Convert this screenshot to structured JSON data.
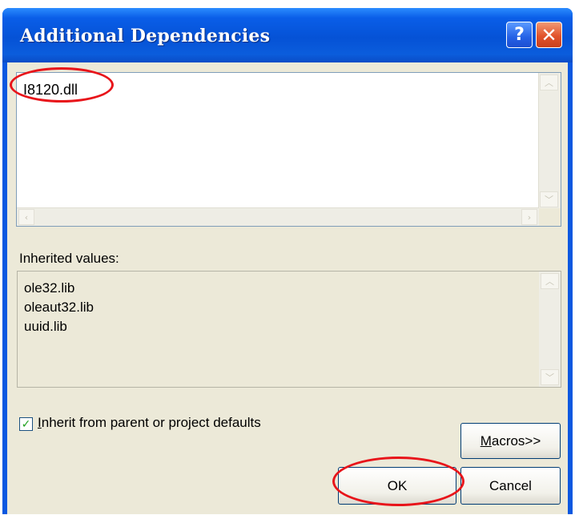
{
  "window": {
    "title": "Additional Dependencies",
    "help_glyph": "?",
    "close_glyph": "✕"
  },
  "editor": {
    "text": "I8120.dll"
  },
  "inherited": {
    "label": "Inherited values:",
    "items": [
      "ole32.lib",
      "oleaut32.lib",
      "uuid.lib"
    ]
  },
  "inherit_checkbox": {
    "checked": true,
    "label_first": "I",
    "label_rest": "nherit from parent or project defaults"
  },
  "buttons": {
    "macros_first": "M",
    "macros_rest": "acros>>",
    "ok": "OK",
    "cancel": "Cancel"
  },
  "annotations": {
    "color": "#e8141a",
    "highlighted": [
      "dll-entry",
      "ok-button"
    ]
  }
}
